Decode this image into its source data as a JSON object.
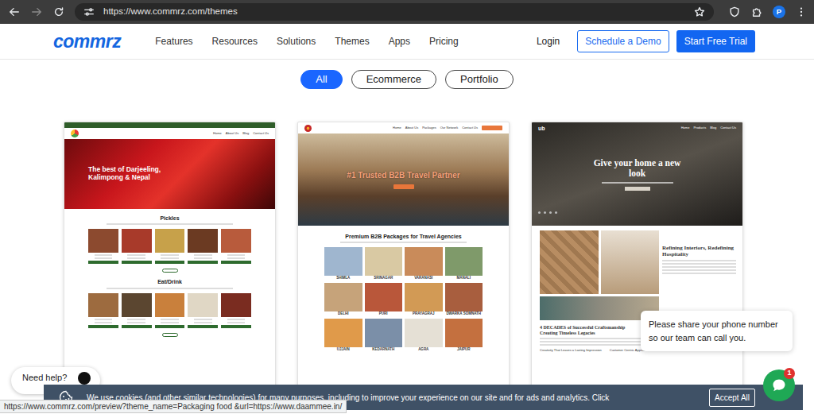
{
  "browser": {
    "url": "https://www.commrz.com/themes",
    "profile": "P",
    "status_url": "https://www.commrz.com/preview?theme_name=Packaging food &url=https://www.daammee.in/"
  },
  "nav": {
    "logo": "commrz",
    "items": [
      "Features",
      "Resources",
      "Solutions",
      "Themes",
      "Apps",
      "Pricing"
    ],
    "login": "Login",
    "demo": "Schedule a Demo",
    "trial": "Start Free Trial"
  },
  "filters": [
    {
      "label": "All",
      "selected": true
    },
    {
      "label": "Ecommerce",
      "selected": false
    },
    {
      "label": "Portfolio",
      "selected": false
    }
  ],
  "themes": [
    {
      "kind": "shop",
      "nav": [
        "Home",
        "About Us",
        "Blog",
        "Contact Us"
      ],
      "hero": "The best of Darjeeling, Kalimpong & Nepal",
      "sections": [
        "Pickles",
        "Eat/Drink"
      ]
    },
    {
      "kind": "travel",
      "nav": [
        "Home",
        "About Us",
        "Packages",
        "Our Network",
        "Contact Us"
      ],
      "hero": "#1 Trusted B2B Travel Partner",
      "section": "Premium B2B Packages for Travel Agencies",
      "places": [
        "SHIMLA",
        "SRINAGAR",
        "VARANASI",
        "MANALI",
        "DELHI",
        "PURI",
        "PRAYAGRAJ",
        "DWARKA SOMNATH",
        "UJJAIN",
        "KEDARNATH",
        "AGRA",
        "JAIPUR"
      ]
    },
    {
      "kind": "interior",
      "logo": "ub",
      "nav": [
        "Home",
        "Products",
        "Blog",
        "Contact Us"
      ],
      "hero": "Give your home a new look",
      "heading": "Refining Interiors, Redefining Hospitality",
      "footer_heading": "4 DECADES of Successful Craftsmanship Creating Timeless Legacies",
      "features": [
        "Creativity That Leaves a Lasting Impression",
        "Customer Centric Approach"
      ]
    }
  ],
  "chat": {
    "message": "Please share your phone number so our team can call you.",
    "badge": "1"
  },
  "help": {
    "label": "Need help?"
  },
  "cookie": {
    "text": "We use cookies (and other similar technologies) for many purposes, including to improve your experience on our site and for ads and analytics. Click",
    "accept": "Accept All"
  }
}
